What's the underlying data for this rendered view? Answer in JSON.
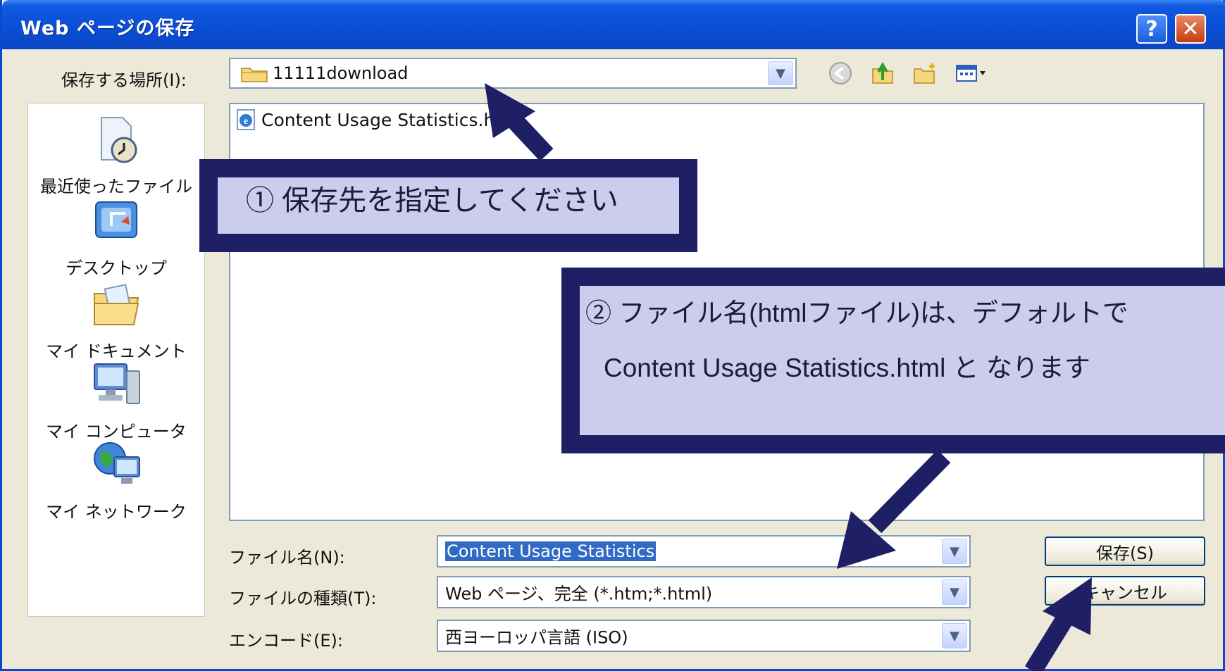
{
  "window": {
    "title": "Web ページの保存",
    "help_label": "?",
    "close_label": "✕"
  },
  "location": {
    "label": "保存する場所(I):",
    "value": "11111download"
  },
  "places": [
    {
      "label": "最近使ったファイル",
      "icon": "recent-documents-icon"
    },
    {
      "label": "デスクトップ",
      "icon": "desktop-icon"
    },
    {
      "label": "マイ ドキュメント",
      "icon": "my-documents-icon"
    },
    {
      "label": "マイ コンピュータ",
      "icon": "my-computer-icon"
    },
    {
      "label": "マイ ネットワーク",
      "icon": "my-network-icon"
    }
  ],
  "files": [
    {
      "name": "Content Usage Statistics.htm",
      "icon": "ie-document-icon"
    }
  ],
  "fields": {
    "filename_label": "ファイル名(N):",
    "filename_value": "Content Usage Statistics",
    "filetype_label": "ファイルの種類(T):",
    "filetype_value": "Web ページ、完全 (*.htm;*.html)",
    "encoding_label": "エンコード(E):",
    "encoding_value": "西ヨーロッパ言語 (ISO)"
  },
  "buttons": {
    "save": "保存(S)",
    "cancel": "キャンセル"
  },
  "callouts": {
    "step1": "① 保存先を指定してください",
    "step2_line1": "② ファイル名(htmlファイル)は、デフォルトで",
    "step2_line2": "Content Usage Statistics.html と なります"
  },
  "colors": {
    "titlebar": "#0b4fd6",
    "callout_border": "#1f1f66",
    "callout_fill": "#ccccee",
    "arrow": "#1f1f66",
    "selection": "#316ac5"
  }
}
